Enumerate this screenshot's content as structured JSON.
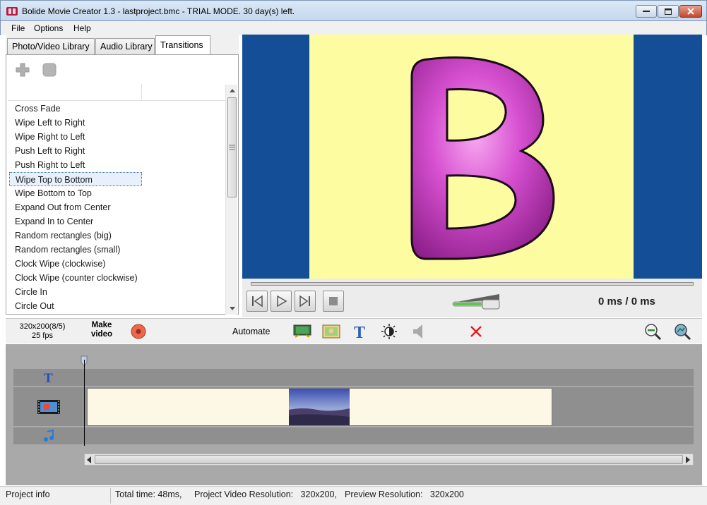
{
  "window": {
    "title": "Bolide Movie Creator 1.3 - lastproject.bmc  - TRIAL MODE. 30 day(s) left.",
    "icon": "film-reel-icon"
  },
  "menu": [
    "File",
    "Options",
    "Help"
  ],
  "library": {
    "tabs": [
      "Photo/Video Library",
      "Audio Library",
      "Transitions"
    ],
    "active_tab": "Transitions",
    "toolbar_icons": [
      "add-icon",
      "remove-icon"
    ],
    "items": [
      "Cross Fade",
      "Wipe Left to Right",
      "Wipe Right to Left",
      "Push Left to Right",
      "Push Right to Left",
      "Wipe Top to Bottom",
      "Wipe Bottom to Top",
      "Expand Out from Center",
      "Expand In to Center",
      "Random rectangles (big)",
      "Random rectangles (small)",
      "Clock Wipe (clockwise)",
      "Clock Wipe (counter clockwise)",
      "Circle In",
      "Circle Out"
    ],
    "selected_item": "Wipe Top to Bottom"
  },
  "preview": {
    "letter": "B",
    "colors": {
      "background": "#144e96",
      "canvas": "#fdfca0",
      "letter": "#cc33cc"
    },
    "progress": 0,
    "volume": 0.9,
    "time_current": "0 ms",
    "time_total": " / 0 ms",
    "buttons": [
      "previous-icon",
      "play-icon",
      "next-icon",
      "stop-icon"
    ]
  },
  "toolbar": {
    "resolution": "320x200(8/5)",
    "fps": "25 fps",
    "make_video_line1": "Make",
    "make_video_line2": "video",
    "automate": "Automate",
    "icons": [
      "record-icon",
      "film-strip-icon",
      "photo-icon",
      "text-icon",
      "brightness-icon",
      "volume-icon",
      "delete-icon",
      "zoom-out-icon",
      "zoom-fit-icon"
    ]
  },
  "timeline": {
    "tracks": [
      "text-track-icon",
      "video-track-icon",
      "audio-track-icon"
    ],
    "clip_thumbnail": "landscape-thumbnail"
  },
  "status": {
    "project_info": "Project info",
    "total_time": "Total time: 48ms,",
    "video_resolution": "Project Video Resolution:   320x200,",
    "preview_resolution": "Preview Resolution:   320x200"
  }
}
